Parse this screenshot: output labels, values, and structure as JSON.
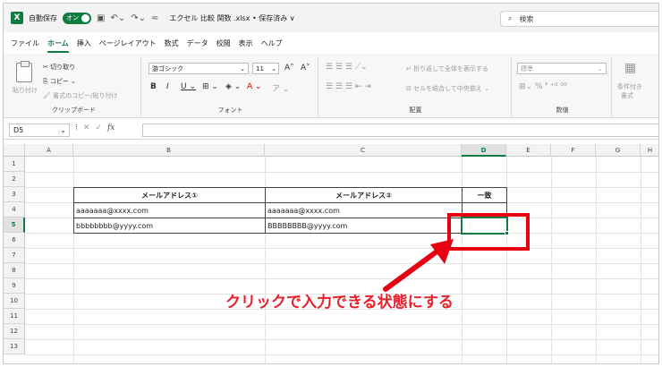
{
  "titlebar": {
    "autosave_label": "自動保存",
    "autosave_state": "オン",
    "file_title": "エクセル 比較 関数 .xlsx • 保存済み ∨",
    "search_placeholder": "検索"
  },
  "menu": [
    "ファイル",
    "ホーム",
    "挿入",
    "ページレイアウト",
    "数式",
    "データ",
    "校閲",
    "表示",
    "ヘルプ"
  ],
  "active_menu": "ホーム",
  "ribbon": {
    "clipboard": {
      "paste": "貼り付け",
      "cut": "切り取り",
      "copy": "コピー",
      "format_painter": "書式のコピー/貼り付け",
      "label": "クリップボード"
    },
    "font": {
      "name": "游ゴシック",
      "size": "11",
      "label": "フォント"
    },
    "alignment": {
      "wrap": "折り返して全体を表示する",
      "merge": "セルを結合して中央揃え",
      "label": "配置"
    },
    "number": {
      "format": "標準",
      "label": "数値"
    },
    "styles": {
      "conditional": "条件付き",
      "conditional2": "書式"
    }
  },
  "formula_bar": {
    "name_box": "D5",
    "fx": "fx",
    "value": ""
  },
  "columns": [
    "A",
    "B",
    "C",
    "D",
    "E",
    "F",
    "G",
    "H"
  ],
  "rows": [
    "1",
    "2",
    "3",
    "4",
    "5",
    "6",
    "7",
    "8",
    "9",
    "10",
    "11",
    "12",
    "13"
  ],
  "selected_cell": {
    "column": "D",
    "row": "5"
  },
  "table": {
    "headers": [
      "メールアドレス①",
      "メールアドレス②",
      "一致"
    ],
    "rows": [
      [
        "aaaaaaa@xxxx.com",
        "aaaaaaa@xxxx.com",
        ""
      ],
      [
        "bbbbbbbb@yyyy.com",
        "BBBBBBBB@yyyy.com",
        ""
      ]
    ]
  },
  "annotation": {
    "text": "クリックで入力できる状態にする",
    "color": "#e60012"
  }
}
